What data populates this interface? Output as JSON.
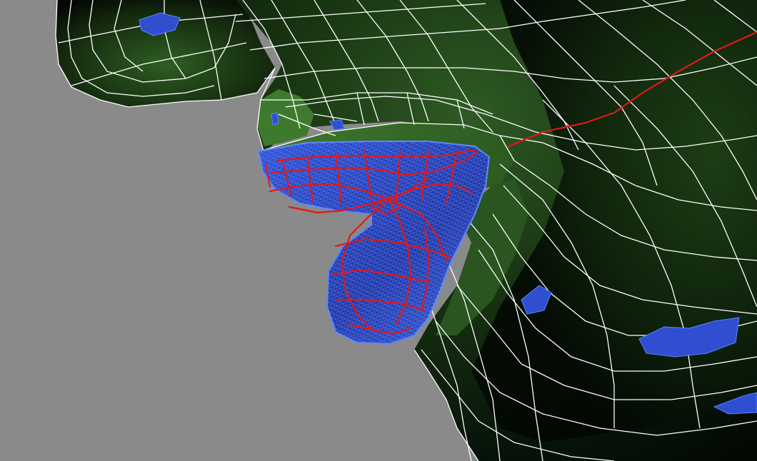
{
  "viewport": {
    "background": "#8a8a8a",
    "surface_dark": "#050d04",
    "surface_mid": "#1d3a16",
    "surface_light": "#4f8a3e",
    "wire_color": "#ffffff",
    "selection_fill": "#2b49c8",
    "selection_edge": "#5a86ff",
    "curve_color": "#e01818"
  }
}
